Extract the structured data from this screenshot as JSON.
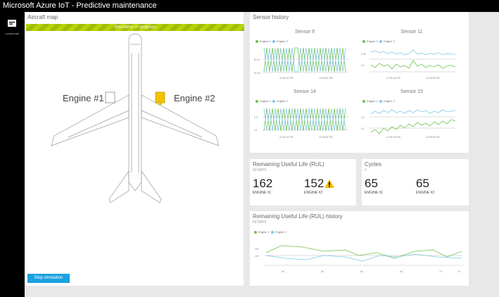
{
  "app": {
    "title": "Microsoft Azure IoT - Predictive maintenance"
  },
  "nav": {
    "dashboard_label": "DASHBOARD"
  },
  "aircraft_map": {
    "title": "Aircraft map",
    "progress_text": "Simulation in progress",
    "engine1_label": "Engine #1",
    "engine2_label": "Engine #2",
    "stop_button": "Stop simulation"
  },
  "sensor_history": {
    "title": "Sensor history",
    "legend": [
      "Engine 1",
      "Engine 2"
    ],
    "charts": [
      {
        "title": "Sensor 9",
        "y_ticks": [
          "$1.xx",
          "$1.00"
        ],
        "x_ticks": [
          "12:56:44 PM",
          "12:56:54 PM"
        ]
      },
      {
        "title": "Sensor 11",
        "y_ticks": [
          "0.28",
          "0.2"
        ],
        "x_ticks": [
          "12:56:44 PM",
          "12:56:54 PM"
        ]
      },
      {
        "title": "Sensor 14",
        "y_ticks": [
          "0.2",
          "0.1"
        ],
        "x_ticks": [
          "12:56:44 PM",
          "12:56:54 PM"
        ]
      },
      {
        "title": "Sensor 15",
        "y_ticks": [
          "0.2",
          "0.1"
        ],
        "x_ticks": [
          "12:56:44 PM",
          "12:56:54 PM"
        ]
      }
    ]
  },
  "rul": {
    "title": "Remaining Useful Life (RUL)",
    "unit": "IN DAYS",
    "engine1": {
      "value": "162",
      "label": "ENGINE #1"
    },
    "engine2": {
      "value": "152",
      "label": "ENGINE #2",
      "warning": true
    }
  },
  "cycles": {
    "title": "Cycles",
    "sub": "#",
    "engine1": {
      "value": "65",
      "label": "ENGINE #1"
    },
    "engine2": {
      "value": "65",
      "label": "ENGINE #2"
    }
  },
  "rul_history": {
    "title": "Remaining Useful Life (RUL) history",
    "unit": "IN DAYS",
    "legend": [
      "Engine 1",
      "Engine 2"
    ],
    "y_ticks": [
      "200",
      "100"
    ],
    "x_ticks": [
      "50",
      "55",
      "60",
      "65",
      "70",
      "75"
    ]
  },
  "colors": {
    "engine1": "#6cc24a",
    "engine2": "#80c7ea",
    "accent": "#1ba1e2",
    "warning": "#f2c100"
  }
}
